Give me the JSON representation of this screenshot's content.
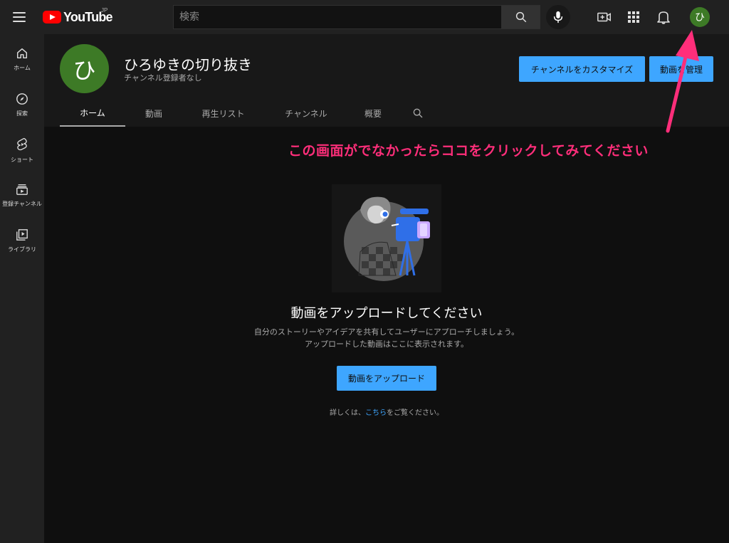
{
  "topbar": {
    "logo_text": "YouTube",
    "logo_region": "JP",
    "search_placeholder": "検索",
    "avatar_initial": "ひ"
  },
  "sidebar": {
    "items": [
      {
        "label": "ホーム",
        "icon": "home-icon"
      },
      {
        "label": "探索",
        "icon": "compass-icon"
      },
      {
        "label": "ショート",
        "icon": "shorts-icon"
      },
      {
        "label": "登録チャンネル",
        "icon": "subscriptions-icon"
      },
      {
        "label": "ライブラリ",
        "icon": "library-icon"
      }
    ]
  },
  "channel": {
    "avatar_initial": "ひ",
    "name": "ひろゆきの切り抜き",
    "subscribers": "チャンネル登録者なし",
    "customize_label": "チャンネルをカスタマイズ",
    "manage_label": "動画を管理"
  },
  "tabs": [
    {
      "label": "ホーム",
      "active": true
    },
    {
      "label": "動画"
    },
    {
      "label": "再生リスト"
    },
    {
      "label": "チャンネル"
    },
    {
      "label": "概要"
    }
  ],
  "empty_state": {
    "title": "動画をアップロードしてください",
    "desc_line1": "自分のストーリーやアイデアを共有してユーザーにアプローチしましょう。",
    "desc_line2": "アップロードした動画はここに表示されます。",
    "upload_label": "動画をアップロード",
    "more_prefix": "詳しくは、",
    "more_link": "こちら",
    "more_suffix": "をご覧ください。"
  },
  "annotation": {
    "text": "この画面がでなかったらココをクリックしてみてください",
    "color": "#ff2e7a"
  },
  "colors": {
    "accent": "#3ea6ff",
    "avatar": "#3d7a26",
    "brand_red": "#ff0000"
  }
}
